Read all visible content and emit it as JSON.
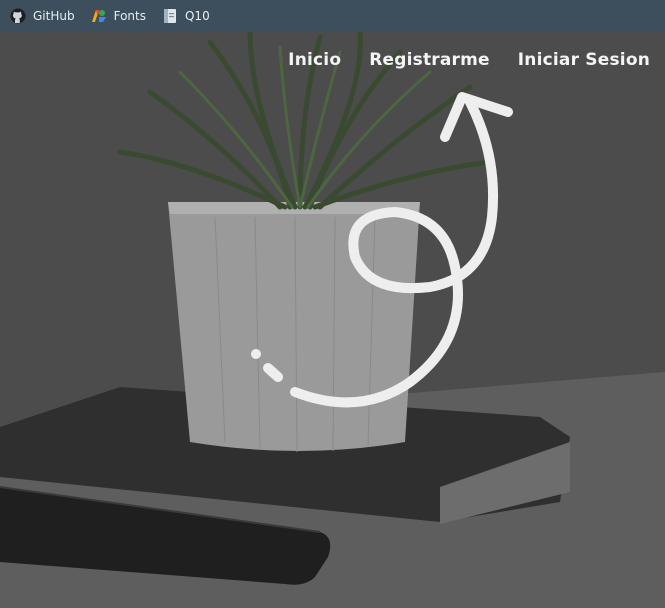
{
  "bookmarks": [
    {
      "label": "GitHub",
      "icon": "github-icon"
    },
    {
      "label": "Fonts",
      "icon": "google-fonts-icon"
    },
    {
      "label": "Q10",
      "icon": "document-icon"
    }
  ],
  "nav": {
    "inicio": "Inicio",
    "registrarme": "Registrarme",
    "iniciar_sesion": "Iniciar Sesion"
  },
  "colors": {
    "bookmarks_bar": "#3d4f5c",
    "overlay": "#4a4a4a",
    "nav_text": "#f4f4f4",
    "arrow": "#eeeeee"
  }
}
